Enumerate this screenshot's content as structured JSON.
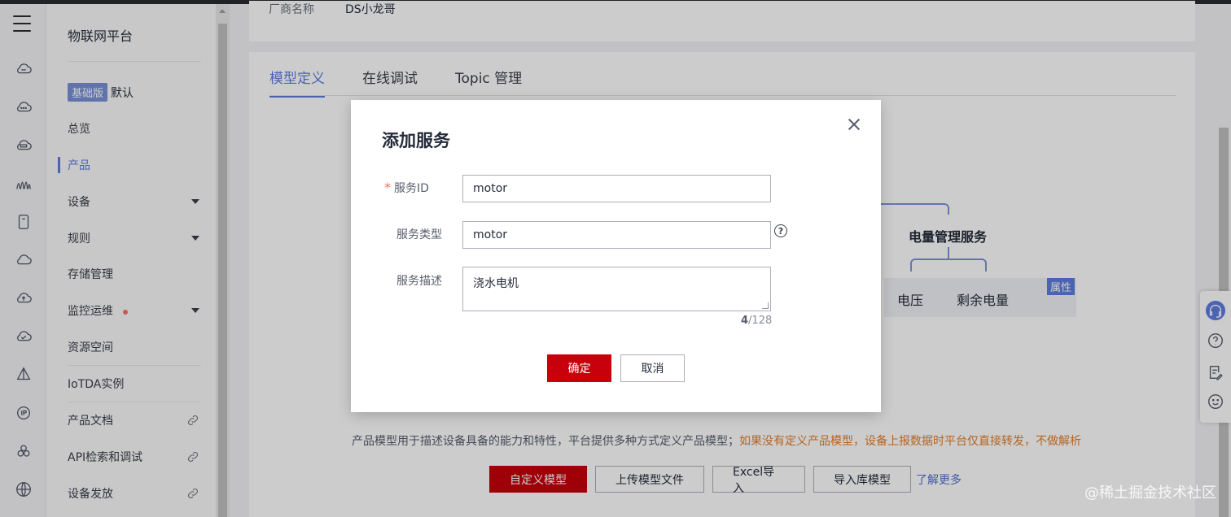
{
  "sidebar": {
    "title": "物联网平台",
    "edition_badge": "基础版",
    "edition_label": "默认",
    "items": [
      {
        "label": "总览"
      },
      {
        "label": "产品"
      },
      {
        "label": "设备"
      },
      {
        "label": "规则"
      },
      {
        "label": "存储管理"
      },
      {
        "label": "监控运维"
      },
      {
        "label": "资源空间"
      },
      {
        "label": "IoTDA实例"
      },
      {
        "label": "产品文档"
      },
      {
        "label": "API检索和调试"
      },
      {
        "label": "设备发放"
      }
    ]
  },
  "header": {
    "vendor_label": "厂商名称",
    "vendor_value": "DS小龙哥"
  },
  "tabs": [
    {
      "label": "模型定义"
    },
    {
      "label": "在线调试"
    },
    {
      "label": "Topic 管理"
    }
  ],
  "diagram": {
    "service_name": "电量管理服务",
    "prop_1": "电压",
    "prop_2": "剩余电量",
    "badge": "属性"
  },
  "description": {
    "normal": "产品模型用于描述设备具备的能力和特性，平台提供多种方式定义产品模型；",
    "warning": "如果没有定义产品模型，设备上报数据时平台仅直接转发，不做解析"
  },
  "actions": {
    "custom_model": "自定义模型",
    "upload_model": "上传模型文件",
    "excel_import": "Excel导入",
    "import_library": "导入库模型",
    "learn_more": "了解更多"
  },
  "modal": {
    "title": "添加服务",
    "service_id_label": "服务ID",
    "service_id_value": "motor",
    "service_type_label": "服务类型",
    "service_type_value": "motor",
    "service_desc_label": "服务描述",
    "service_desc_value": "浇水电机",
    "counter_current": "4",
    "counter_max": "/128",
    "ok_label": "确定",
    "cancel_label": "取消"
  },
  "watermark": "@稀土掘金技术社区"
}
